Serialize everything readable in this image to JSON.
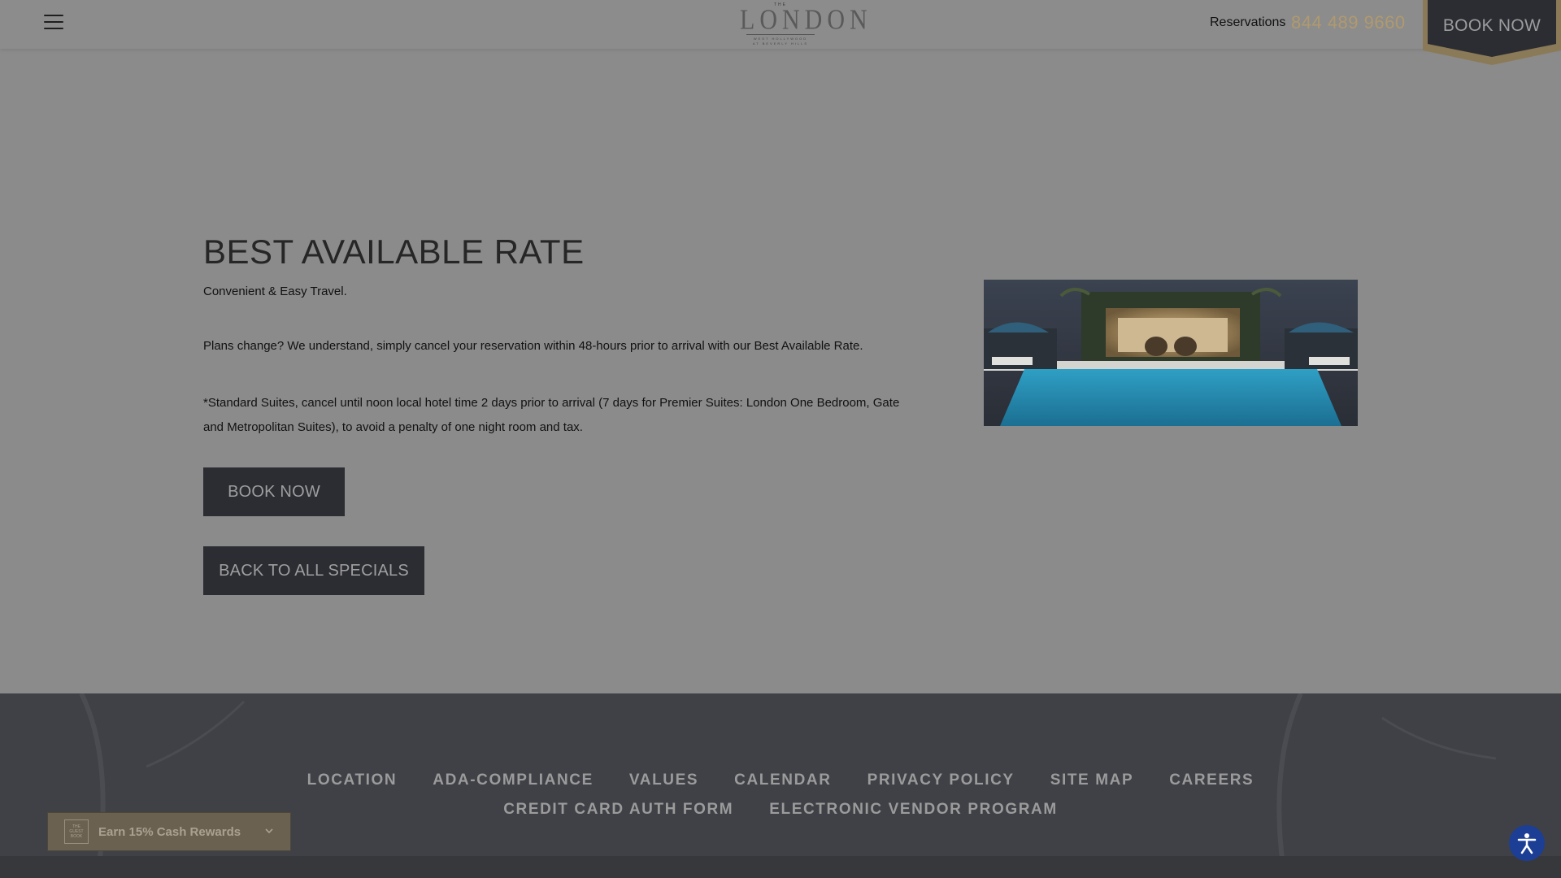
{
  "header": {
    "logo": {
      "top": "THE",
      "main": "LONDON",
      "sub1": "WEST HOLLYWOOD",
      "sub2": "AT BEVERLY HILLS"
    },
    "reservations_label": "Reservations",
    "phone": "844 489 9660",
    "book_now": "BOOK NOW"
  },
  "main": {
    "title": "BEST AVAILABLE RATE",
    "subtitle": "Convenient & Easy Travel.",
    "para1": "Plans change? We understand, simply cancel your reservation within 48-hours prior to arrival with our Best Available Rate.",
    "para2": "*Standard Suites, cancel until noon local hotel time 2 days prior to arrival (7 days for Premier Suites: London One Bedroom, Gate and Metropolitan Suites), to avoid a penalty of one night room and tax.",
    "book_now": "BOOK NOW",
    "back": "BACK TO ALL SPECIALS"
  },
  "footer": {
    "links": [
      "LOCATION",
      "ADA-COMPLIANCE",
      "VALUES",
      "CALENDAR",
      "PRIVACY POLICY",
      "SITE MAP",
      "CAREERS",
      "CREDIT CARD AUTH FORM",
      "ELECTRONIC VENDOR PROGRAM"
    ]
  },
  "cash_rewards": {
    "logo": "THE GUEST BOOK",
    "label": "Earn 15% Cash Rewards"
  },
  "icons": {
    "menu": "hamburger-menu-icon",
    "chevron": "chevron-down-icon",
    "accessibility": "accessibility-icon"
  },
  "colors": {
    "phone": "#b09a6e",
    "button": "#2b2d33",
    "footer": "#3f4146",
    "accessibility": "#1c3f95",
    "gold_trim": "#8a7a58"
  }
}
